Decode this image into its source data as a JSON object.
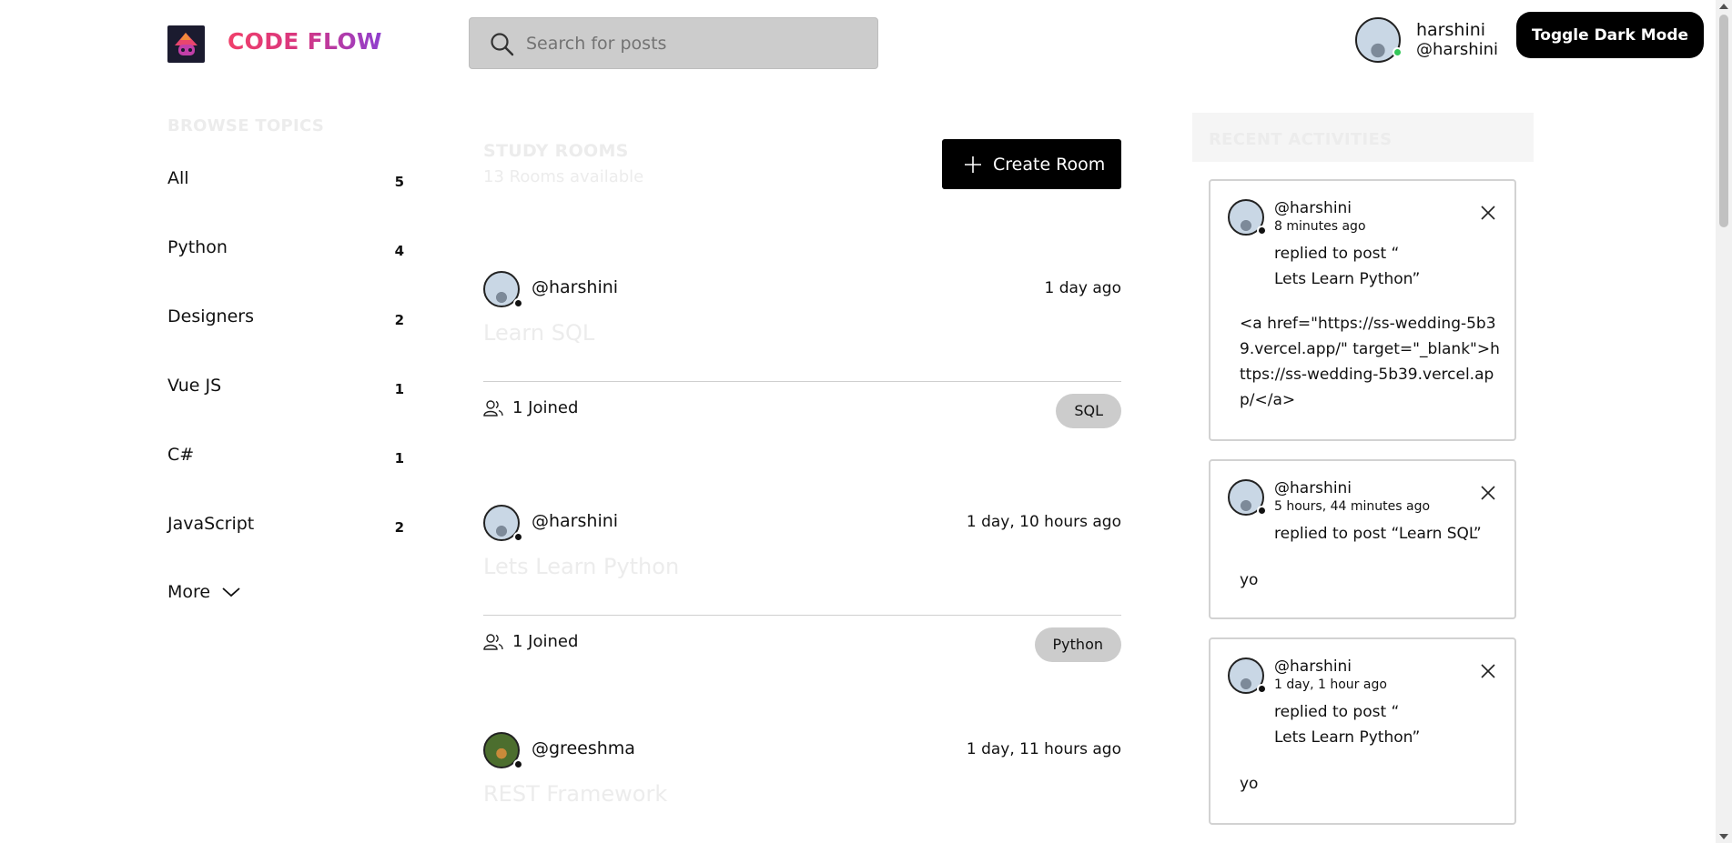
{
  "header": {
    "brand": "CODE FLOW",
    "search_placeholder": "Search for posts",
    "user_name": "harshini",
    "user_handle": "@harshini",
    "toggle_label": "Toggle Dark Mode"
  },
  "topics": {
    "heading": "BROWSE TOPICS",
    "items": [
      {
        "name": "All",
        "count": "5"
      },
      {
        "name": "Python",
        "count": "4"
      },
      {
        "name": "Designers",
        "count": "2"
      },
      {
        "name": "Vue JS",
        "count": "1"
      },
      {
        "name": "C#",
        "count": "1"
      },
      {
        "name": "JavaScript",
        "count": "2"
      }
    ],
    "more_label": "More"
  },
  "rooms": {
    "title": "STUDY ROOMS",
    "count": "13 Rooms available",
    "create_label": "Create Room",
    "items": [
      {
        "host": "@harshini",
        "time": "1 day ago",
        "name": "Learn SQL",
        "joined": "1 Joined",
        "topic": "SQL"
      },
      {
        "host": "@harshini",
        "time": "1 day, 10 hours ago",
        "name": "Lets Learn Python",
        "joined": "1 Joined",
        "topic": "Python"
      },
      {
        "host": "@greeshma",
        "time": "1 day, 11 hours ago",
        "name": "REST Framework"
      }
    ]
  },
  "activities": {
    "title": "RECENT ACTIVITIES",
    "items": [
      {
        "user": "@harshini",
        "time": "8 minutes ago",
        "action": "replied to post “\nLets Learn Python”",
        "message": "<a href=\"https://ss-wedding-5b39.vercel.app/\" target=\"_blank\">https://ss-wedding-5b39.vercel.app/</a>"
      },
      {
        "user": "@harshini",
        "time": "5 hours, 44 minutes ago",
        "action": "replied to post “Learn SQL”",
        "message": "yo"
      },
      {
        "user": "@harshini",
        "time": "1 day, 1 hour ago",
        "action": "replied to post “\nLets Learn Python”",
        "message": "yo"
      }
    ]
  },
  "colors": {
    "brand_gradient_start": "#f0406a",
    "brand_gradient_end": "#8e3fd0",
    "online": "#34c759",
    "button": "#000000",
    "muted_heading": "#ececec"
  }
}
